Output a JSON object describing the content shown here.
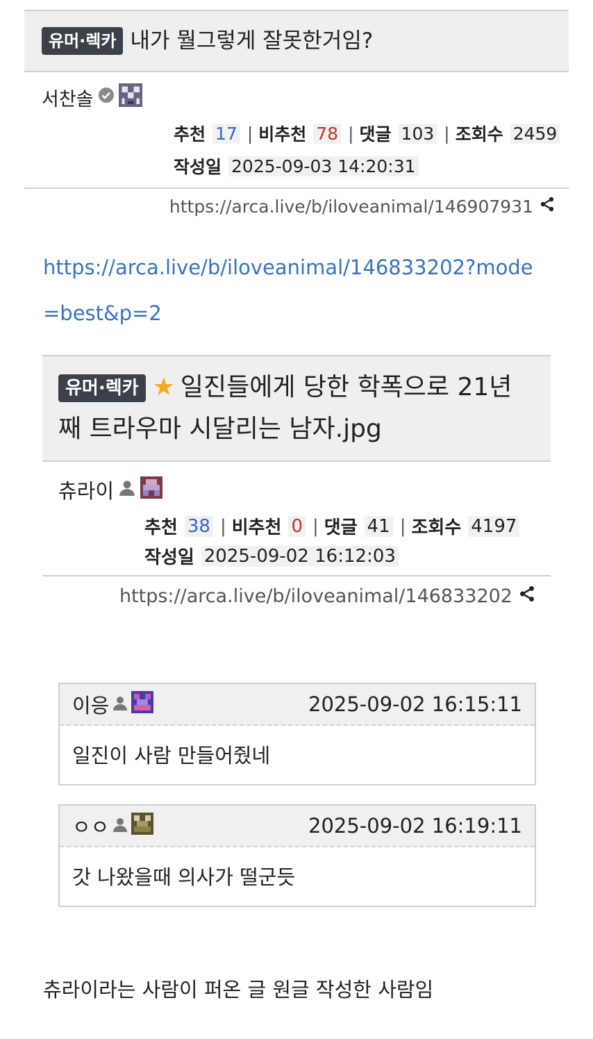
{
  "post": {
    "badge": "유머·렉카",
    "title": "내가 뭘그렇게 잘못한거임?",
    "author": "서찬솔",
    "stats": {
      "recommend_label": "추천",
      "recommend": "17",
      "unrecommend_label": "비추천",
      "unrecommend": "78",
      "comments_label": "댓글",
      "comments": "103",
      "views_label": "조회수",
      "views": "2459",
      "date_label": "작성일",
      "date": "2025-09-03 14:20:31"
    },
    "url": "https://arca.live/b/iloveanimal/146907931"
  },
  "body_link": {
    "line1": "https://arca.live/b/iloveanimal/146833202?mode",
    "line2": "=best&p=2"
  },
  "embedded": {
    "badge": "유머·렉카",
    "title_line1": "일진들에게 당한 학폭으로 21년",
    "title_line2": "째 트라우마 시달리는 남자.jpg",
    "author": "츄라이",
    "stats": {
      "recommend_label": "추천",
      "recommend": "38",
      "unrecommend_label": "비추천",
      "unrecommend": "0",
      "comments_label": "댓글",
      "comments": "41",
      "views_label": "조회수",
      "views": "4197",
      "date_label": "작성일",
      "date": "2025-09-02 16:12:03"
    },
    "url": "https://arca.live/b/iloveanimal/146833202"
  },
  "comments": [
    {
      "author": "이응",
      "date": "2025-09-02 16:15:11",
      "text": "일진이 사람 만들어줬네"
    },
    {
      "author": "ㅇㅇ",
      "date": "2025-09-02 16:19:11",
      "text": "갓 나왔을때 의사가 떨군듯"
    }
  ],
  "footer_text": "츄라이라는 사람이 퍼온 글 원글 작성한 사람임",
  "colors": {
    "accent_link": "#3673c2",
    "recommend": "#3566c9",
    "unrecommend": "#b83a2c",
    "badge_bg": "#3b4148"
  }
}
